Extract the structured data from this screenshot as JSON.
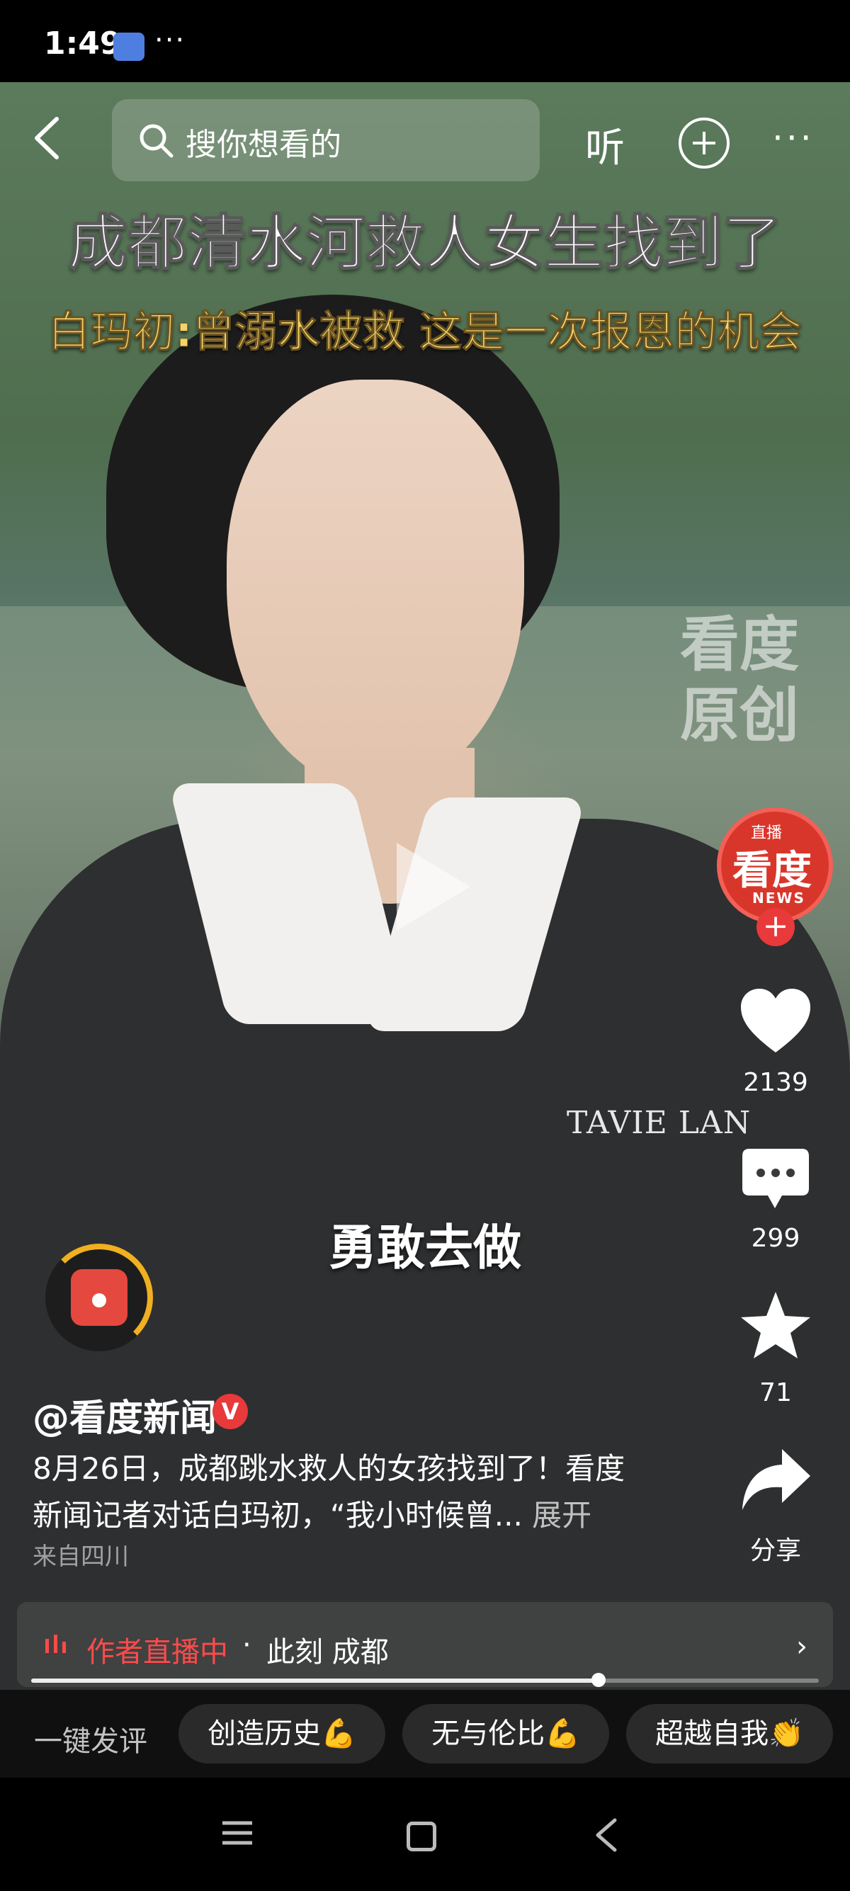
{
  "status_bar": {
    "time": "1:49",
    "more": "···"
  },
  "search": {
    "placeholder": "搜你想看的"
  },
  "top_bar": {
    "listen_label": "听",
    "more_label": "···"
  },
  "video": {
    "headline_title": "成都清水河救人女生找到了",
    "headline_subtitle": "白玛初:曾溺水被救 这是一次报恩的机会",
    "watermark_line1": "看度",
    "watermark_line2": "原创",
    "caption": "勇敢去做",
    "shirt_print": "TAVIE LAN"
  },
  "creator_avatar": {
    "live_tag": "直播",
    "name": "看度",
    "sub": "NEWS",
    "follow": "+"
  },
  "actions": {
    "like_count": "2139",
    "comment_count": "299",
    "favorite_count": "71",
    "share_label": "分享"
  },
  "post": {
    "author": "@看度新闻",
    "verified": "V",
    "description_line1": "8月26日，成都跳水救人的女孩找到了！看度",
    "description_line2": "新闻记者对话白玛初，“我小时候曾...",
    "expand": "展开",
    "location": "来自四川"
  },
  "live_bar": {
    "label": "作者直播中",
    "separator": "·",
    "location": "此刻 成都",
    "chevron": "›"
  },
  "progress": {
    "fraction": 0.72
  },
  "quick_comment": {
    "label": "一键发评",
    "chips": [
      "创造历史💪",
      "无与伦比💪",
      "超越自我👏"
    ]
  },
  "colors": {
    "live_red": "#ff4a4a",
    "badge_red": "#e8393b",
    "headline_yellow": "#f3d46b"
  }
}
